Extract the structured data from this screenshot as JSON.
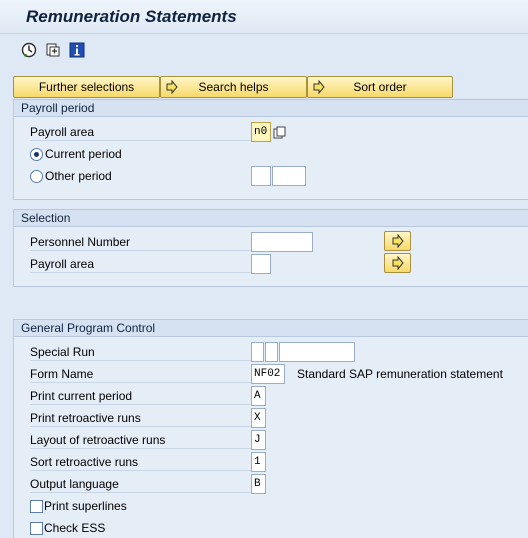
{
  "window": {
    "title": "Remuneration Statements"
  },
  "toolbar": {
    "icons": [
      {
        "name": "execute-icon"
      },
      {
        "name": "save-variant-icon"
      },
      {
        "name": "info-icon"
      }
    ]
  },
  "buttons": {
    "further_selections": "Further selections",
    "search_helps": "Search helps",
    "sort_order": "Sort order"
  },
  "payroll_period": {
    "title": "Payroll period",
    "payroll_area_label": "Payroll area",
    "payroll_area_value": "n0",
    "current_period_label": "Current period",
    "current_period_selected": true,
    "other_period_label": "Other period",
    "other_period_selected": false,
    "other_period_value_1": "",
    "other_period_value_2": ""
  },
  "selection": {
    "title": "Selection",
    "personnel_number_label": "Personnel Number",
    "personnel_number_value": "",
    "payroll_area_label": "Payroll area",
    "payroll_area_value": ""
  },
  "general": {
    "title": "General Program Control",
    "special_run_label": "Special Run",
    "special_run_values": [
      "",
      "",
      ""
    ],
    "form_name_label": "Form Name",
    "form_name_value": "NF02",
    "form_name_desc": "Standard SAP remuneration statement",
    "print_current_period_label": "Print current period",
    "print_current_period_value": "A",
    "print_retro_label": "Print retroactive runs",
    "print_retro_value": "X",
    "layout_retro_label": "Layout of retroactive runs",
    "layout_retro_value": "J",
    "sort_retro_label": "Sort retroactive runs",
    "sort_retro_value": "1",
    "output_language_label": "Output language",
    "output_language_value": "B",
    "print_superlines_label": "Print superlines",
    "print_superlines_checked": false,
    "check_ess_label": "Check ESS",
    "check_ess_checked": false
  },
  "colors": {
    "background": "#dfe9f5",
    "button_yellow": "#f7d96a",
    "required_field": "#fdf6bf",
    "title_text": "#10223f"
  }
}
